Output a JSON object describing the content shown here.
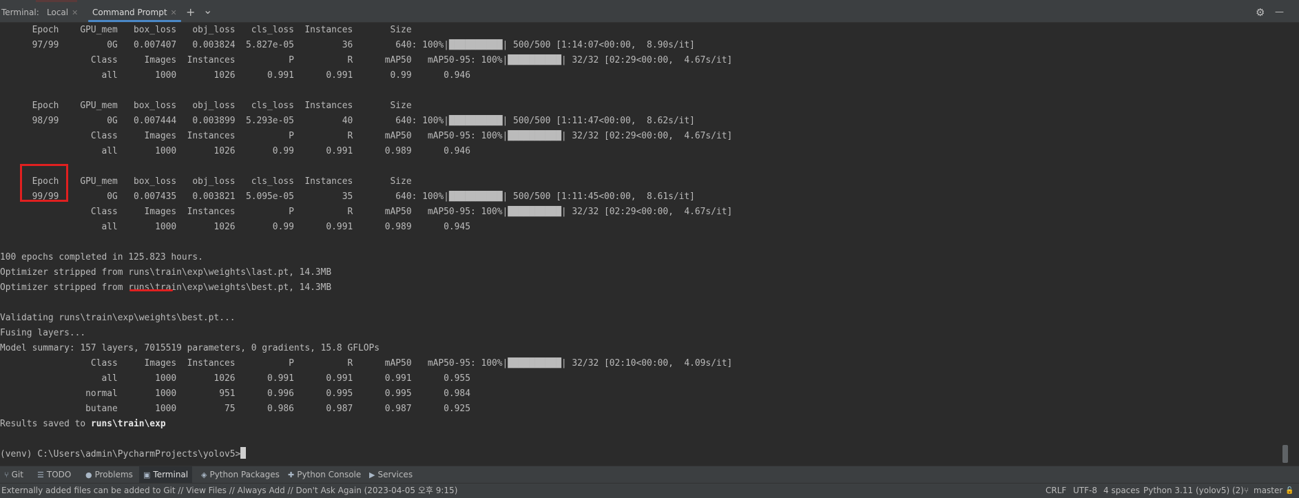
{
  "tabbar": {
    "label": "Terminal:",
    "tabs": [
      {
        "label": "Local",
        "active": false
      },
      {
        "label": "Command Prompt",
        "active": true
      }
    ],
    "add_icon": "+",
    "dropdown_icon": "⌄",
    "settings_icon": "⚙",
    "minimize_icon": "—"
  },
  "terminal": {
    "lines": [
      "      Epoch    GPU_mem   box_loss   obj_loss   cls_loss  Instances       Size",
      "      97/99         0G   0.007407   0.003824  5.827e-05         36        640: 100%|██████████| 500/500 [1:14:07<00:00,  8.90s/it]",
      "                 Class     Images  Instances          P          R      mAP50   mAP50-95: 100%|██████████| 32/32 [02:29<00:00,  4.67s/it]",
      "                   all       1000       1026      0.991      0.991       0.99      0.946",
      "",
      "      Epoch    GPU_mem   box_loss   obj_loss   cls_loss  Instances       Size",
      "      98/99         0G   0.007444   0.003899  5.293e-05         40        640: 100%|██████████| 500/500 [1:11:47<00:00,  8.62s/it]",
      "                 Class     Images  Instances          P          R      mAP50   mAP50-95: 100%|██████████| 32/32 [02:29<00:00,  4.67s/it]",
      "                   all       1000       1026       0.99      0.991      0.989      0.946",
      "",
      "      Epoch    GPU_mem   box_loss   obj_loss   cls_loss  Instances       Size",
      "      99/99         0G   0.007435   0.003821  5.095e-05         35        640: 100%|██████████| 500/500 [1:11:45<00:00,  8.61s/it]",
      "                 Class     Images  Instances          P          R      mAP50   mAP50-95: 100%|██████████| 32/32 [02:29<00:00,  4.67s/it]",
      "                   all       1000       1026       0.99      0.991      0.989      0.945",
      "",
      "100 epochs completed in 125.823 hours.",
      "Optimizer stripped from runs\\train\\exp\\weights\\last.pt, 14.3MB",
      "Optimizer stripped from runs\\train\\exp\\weights\\best.pt, 14.3MB",
      "",
      "Validating runs\\train\\exp\\weights\\best.pt...",
      "Fusing layers...",
      "Model summary: 157 layers, 7015519 parameters, 0 gradients, 15.8 GFLOPs",
      "                 Class     Images  Instances          P          R      mAP50   mAP50-95: 100%|██████████| 32/32 [02:10<00:00,  4.09s/it]",
      "                   all       1000       1026      0.991      0.991      0.991      0.955",
      "                normal       1000        951      0.996      0.995      0.995      0.984",
      "                butane       1000         75      0.986      0.987      0.987      0.925"
    ],
    "results_prefix": "Results saved to ",
    "results_path": "runs\\train\\exp",
    "prompt": "(venv) C:\\Users\\admin\\PycharmProjects\\yolov5>"
  },
  "toolbar": {
    "items": [
      {
        "icon": "⑂",
        "label": "Git"
      },
      {
        "icon": "☰",
        "label": "TODO"
      },
      {
        "icon": "●",
        "label": "Problems"
      },
      {
        "icon": "▣",
        "label": "Terminal"
      },
      {
        "icon": "◈",
        "label": "Python Packages"
      },
      {
        "icon": "✚",
        "label": "Python Console"
      },
      {
        "icon": "▶",
        "label": "Services"
      }
    ]
  },
  "statusbar": {
    "message": "Externally added files can be added to Git // View Files // Always Add // Don't Ask Again (2023-04-05 오후 9:15)",
    "line_sep": "CRLF",
    "encoding": "UTF-8",
    "indent": "4 spaces",
    "interpreter": "Python 3.11 (yolov5) (2)",
    "branch_icon": "⑂",
    "branch": "master",
    "lock_icon": "🔓"
  }
}
